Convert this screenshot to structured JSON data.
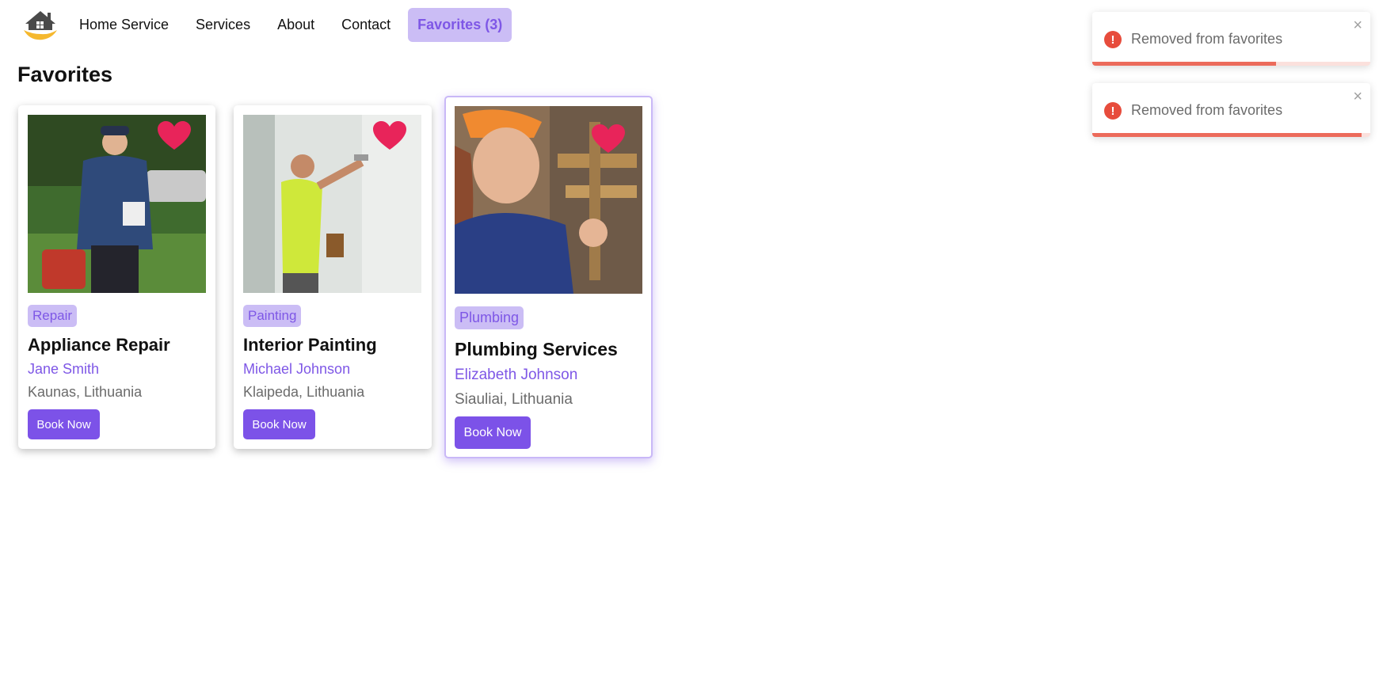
{
  "nav": {
    "brand": "Home Service",
    "links": [
      "Services",
      "About",
      "Contact"
    ],
    "favorites_label": "Favorites (3)"
  },
  "page_title": "Favorites",
  "cards": [
    {
      "tag": "Repair",
      "title": "Appliance Repair",
      "provider": "Jane Smith",
      "location": "Kaunas, Lithuania",
      "button": "Book Now",
      "favorited": true
    },
    {
      "tag": "Painting",
      "title": "Interior Painting",
      "provider": "Michael Johnson",
      "location": "Klaipeda, Lithuania",
      "button": "Book Now",
      "favorited": true
    },
    {
      "tag": "Plumbing",
      "title": "Plumbing Services",
      "provider": "Elizabeth Johnson",
      "location": "Siauliai, Lithuania",
      "button": "Book Now",
      "favorited": true
    }
  ],
  "toasts": [
    {
      "icon": "!",
      "message": "Removed from favorites",
      "close": "×",
      "progress": 0.66
    },
    {
      "icon": "!",
      "message": "Removed from favorites",
      "close": "×",
      "progress": 0.97
    }
  ],
  "colors": {
    "accent": "#7c52e8",
    "tag_bg": "#cbbdf5",
    "heart": "#e8245a",
    "error": "#e74c3c"
  },
  "icons": {
    "logo": "house-hand-logo-icon",
    "favorite": "heart-icon",
    "toast": "error-icon",
    "close": "close-icon"
  }
}
